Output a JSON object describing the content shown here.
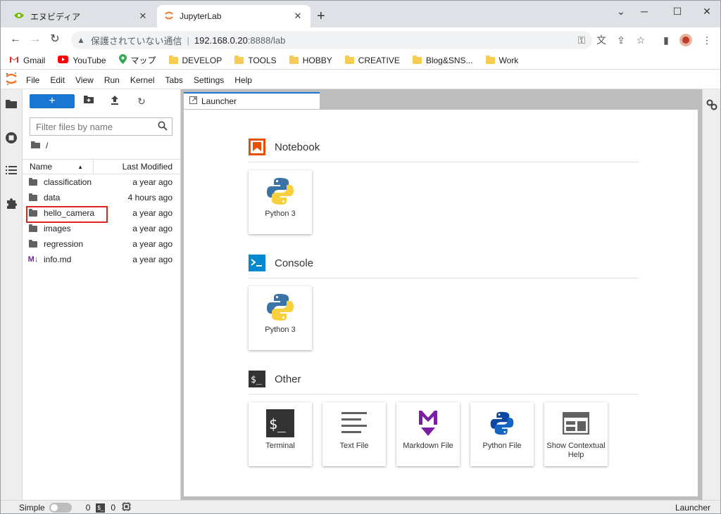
{
  "browser": {
    "tabs": [
      {
        "title": "エヌビディア",
        "active": false
      },
      {
        "title": "JupyterLab",
        "active": true
      }
    ],
    "new_tab": "+",
    "window_controls": {
      "minimize": "─",
      "maximize": "☐",
      "close": "✕",
      "dropdown": "⌄"
    },
    "address": {
      "security_text": "保護されていない通信",
      "host": "192.168.0.20",
      "port": ":8888/lab",
      "separator": "|"
    },
    "bookmarks": [
      {
        "label": "Gmail",
        "icon": "gmail-icon"
      },
      {
        "label": "YouTube",
        "icon": "youtube-icon"
      },
      {
        "label": "マップ",
        "icon": "maps-icon"
      },
      {
        "label": "DEVELOP",
        "icon": "folder-icon"
      },
      {
        "label": "TOOLS",
        "icon": "folder-icon"
      },
      {
        "label": "HOBBY",
        "icon": "folder-icon"
      },
      {
        "label": "CREATIVE",
        "icon": "folder-icon"
      },
      {
        "label": "Blog&SNS...",
        "icon": "folder-icon"
      },
      {
        "label": "Work",
        "icon": "folder-icon"
      }
    ]
  },
  "menu": [
    "File",
    "Edit",
    "View",
    "Run",
    "Kernel",
    "Tabs",
    "Settings",
    "Help"
  ],
  "filebrowser": {
    "new_button": "+",
    "filter_placeholder": "Filter files by name",
    "path": "/",
    "col_name": "Name",
    "col_modified": "Last Modified",
    "items": [
      {
        "name": "classification",
        "modified": "a year ago",
        "type": "folder"
      },
      {
        "name": "data",
        "modified": "4 hours ago",
        "type": "folder"
      },
      {
        "name": "hello_camera",
        "modified": "a year ago",
        "type": "folder",
        "highlighted": true
      },
      {
        "name": "images",
        "modified": "a year ago",
        "type": "folder"
      },
      {
        "name": "regression",
        "modified": "a year ago",
        "type": "folder"
      },
      {
        "name": "info.md",
        "modified": "a year ago",
        "type": "markdown"
      }
    ]
  },
  "launcher": {
    "tab_label": "Launcher",
    "sections": [
      {
        "title": "Notebook",
        "cards": [
          {
            "label": "Python 3"
          }
        ]
      },
      {
        "title": "Console",
        "cards": [
          {
            "label": "Python 3"
          }
        ]
      },
      {
        "title": "Other",
        "cards": [
          {
            "label": "Terminal"
          },
          {
            "label": "Text File"
          },
          {
            "label": "Markdown File"
          },
          {
            "label": "Python File"
          },
          {
            "label": "Show Contextual Help"
          }
        ]
      }
    ]
  },
  "statusbar": {
    "mode": "Simple",
    "terminals": "0",
    "kernels": "0",
    "right": "Launcher"
  },
  "colors": {
    "accent": "#1976d2",
    "highlight_border": "#dd2222",
    "notebook_orange": "#e65100"
  }
}
